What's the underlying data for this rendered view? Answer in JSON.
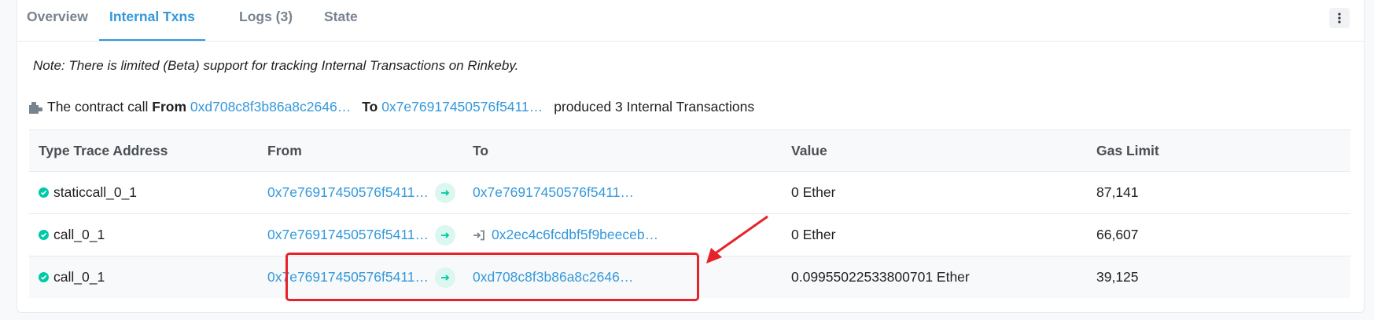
{
  "tabs": [
    {
      "label": "Overview"
    },
    {
      "label": "Internal Txns"
    },
    {
      "label": "Logs (3)"
    },
    {
      "label": "State"
    }
  ],
  "note": "Note: There is limited (Beta) support for tracking Internal Transactions on Rinkeby.",
  "summary": {
    "prefix": "The contract call",
    "from_label": "From",
    "from_addr": "0xd708c8f3b86a8c2646…",
    "to_label": "To",
    "to_addr": "0x7e76917450576f5411…",
    "suffix": "produced 3 Internal Transactions"
  },
  "table": {
    "headers": [
      "Type Trace Address",
      "From",
      "To",
      "Value",
      "Gas Limit"
    ],
    "rows": [
      {
        "type": "staticcall_0_1",
        "from": "0x7e76917450576f5411…",
        "to": "0x7e76917450576f5411…",
        "value": "0 Ether",
        "gas": "87,141"
      },
      {
        "type": "call_0_1",
        "from": "0x7e76917450576f5411…",
        "to": "0x2ec4c6fcdbf5f9beeceb…",
        "value": "0 Ether",
        "gas": "66,607"
      },
      {
        "type": "call_0_1",
        "from": "0x7e76917450576f5411…",
        "to": "0xd708c8f3b86a8c2646…",
        "value": "0.09955022533800701 Ether",
        "gas": "39,125"
      }
    ]
  },
  "icons": {
    "puzzle": "puzzle-icon",
    "check": "check-circle-icon",
    "arrow": "arrow-right-icon",
    "sign_in": "sign-in-icon",
    "more": "more-vertical-icon"
  },
  "colors": {
    "accent": "#3498db",
    "success": "#00c9a7",
    "highlight": "#e8222a"
  }
}
